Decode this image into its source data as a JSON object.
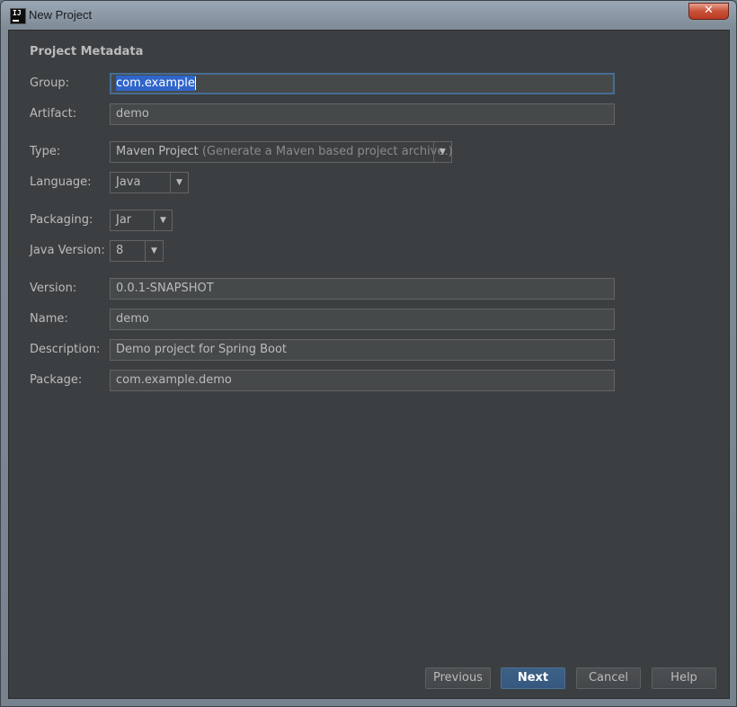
{
  "window": {
    "title": "New Project",
    "close_glyph": "✕",
    "app_icon_text": "IJ"
  },
  "section_title": "Project Metadata",
  "fields": {
    "group": {
      "label": "Group:",
      "value": "com.example"
    },
    "artifact": {
      "label": "Artifact:",
      "value": "demo"
    },
    "type": {
      "label": "Type:",
      "value": "Maven Project",
      "hint": "(Generate a Maven based project archive.)"
    },
    "language": {
      "label": "Language:",
      "value": "Java"
    },
    "packaging": {
      "label": "Packaging:",
      "value": "Jar"
    },
    "java_version": {
      "label": "Java Version:",
      "value": "8"
    },
    "version": {
      "label": "Version:",
      "value": "0.0.1-SNAPSHOT"
    },
    "name": {
      "label": "Name:",
      "value": "demo"
    },
    "description": {
      "label": "Description:",
      "value": "Demo project for Spring Boot"
    },
    "package": {
      "label": "Package:",
      "value": "com.example.demo"
    }
  },
  "buttons": {
    "previous": "Previous",
    "next": "Next",
    "cancel": "Cancel",
    "help": "Help"
  },
  "colors": {
    "panel_bg": "#3c3f41",
    "field_bg": "#45494a",
    "focus_border": "#466d94",
    "primary_button": "#365880",
    "selection": "#2f65ca"
  }
}
